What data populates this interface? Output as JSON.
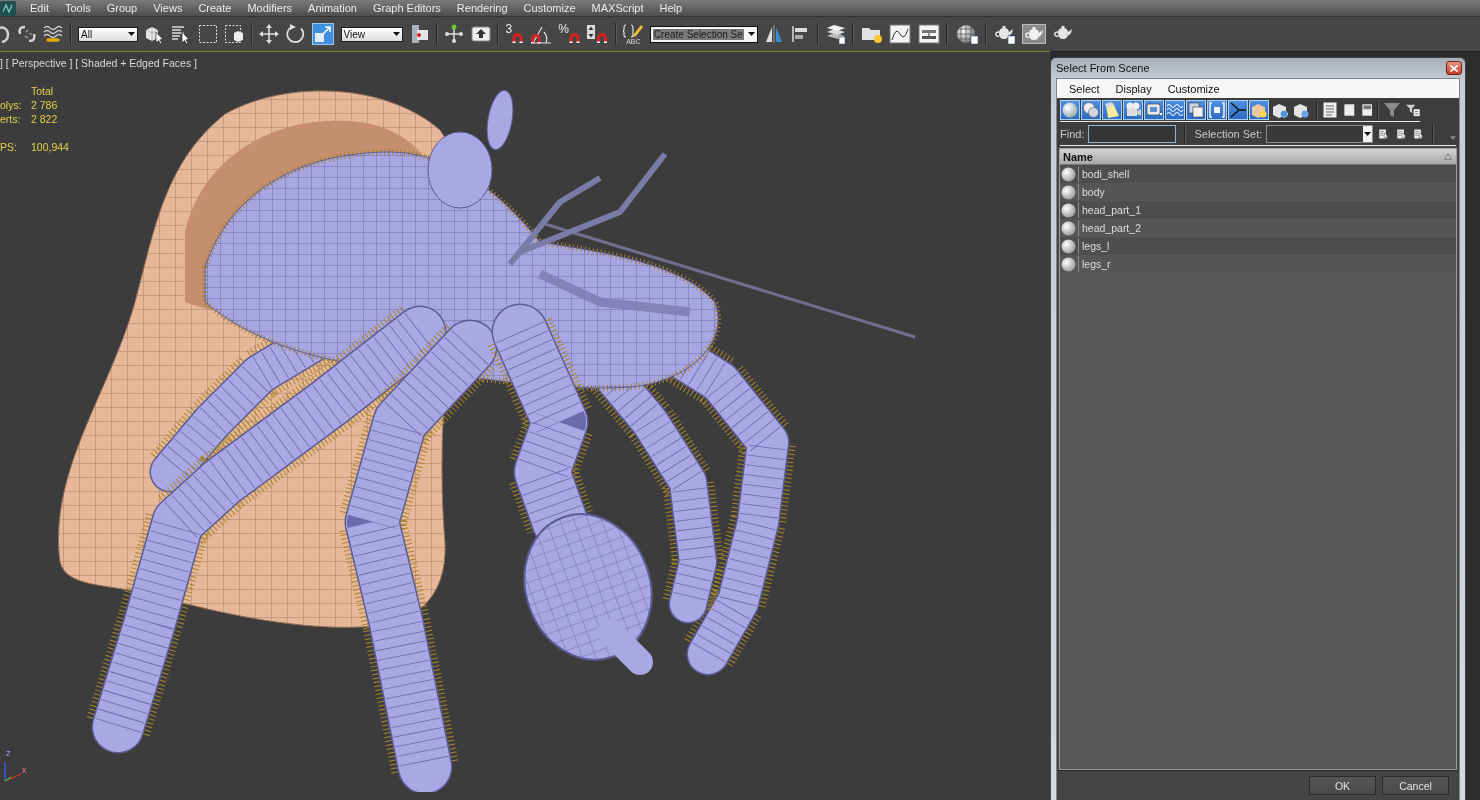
{
  "menu_bar": {
    "items": [
      "Edit",
      "Tools",
      "Group",
      "Views",
      "Create",
      "Modifiers",
      "Animation",
      "Graph Editors",
      "Rendering",
      "Customize",
      "MAXScript",
      "Help"
    ]
  },
  "toolbar": {
    "selection_filter": "All",
    "coordinate_system": "View",
    "snap_label": "3",
    "percent_snap_label": "%",
    "named_selection_label": "ABC",
    "named_selection_set": "Create Selection Se"
  },
  "viewport": {
    "label": "] [ Perspective ] [ Shaded + Edged Faces ]",
    "stats": {
      "header": "Total",
      "rows": [
        {
          "label": "olys:",
          "value": "2 786"
        },
        {
          "label": "erts:",
          "value": "2 822"
        }
      ],
      "fps": {
        "label": "PS:",
        "value": "100,944"
      }
    },
    "axis_labels": [
      "z",
      "x"
    ]
  },
  "dialog": {
    "title": "Select From Scene",
    "menu": [
      "Select",
      "Display",
      "Customize"
    ],
    "filters": [
      {
        "selected": true
      },
      {
        "selected": true
      },
      {
        "selected": true
      },
      {
        "selected": true
      },
      {
        "selected": true
      },
      {
        "selected": true
      },
      {
        "selected": true
      },
      {
        "selected": true
      },
      {
        "selected": true
      },
      {
        "selected": true
      },
      {
        "selected": false
      },
      {
        "selected": false
      }
    ],
    "find_label": "Find:",
    "selection_set_label": "Selection Set:",
    "column": "Name",
    "objects": [
      {
        "name": "bodi_shell"
      },
      {
        "name": "body"
      },
      {
        "name": "head_part_1"
      },
      {
        "name": "head_part_2"
      },
      {
        "name": "legs_l"
      },
      {
        "name": "legs_r"
      }
    ],
    "buttons": [
      "OK",
      "Cancel"
    ]
  }
}
